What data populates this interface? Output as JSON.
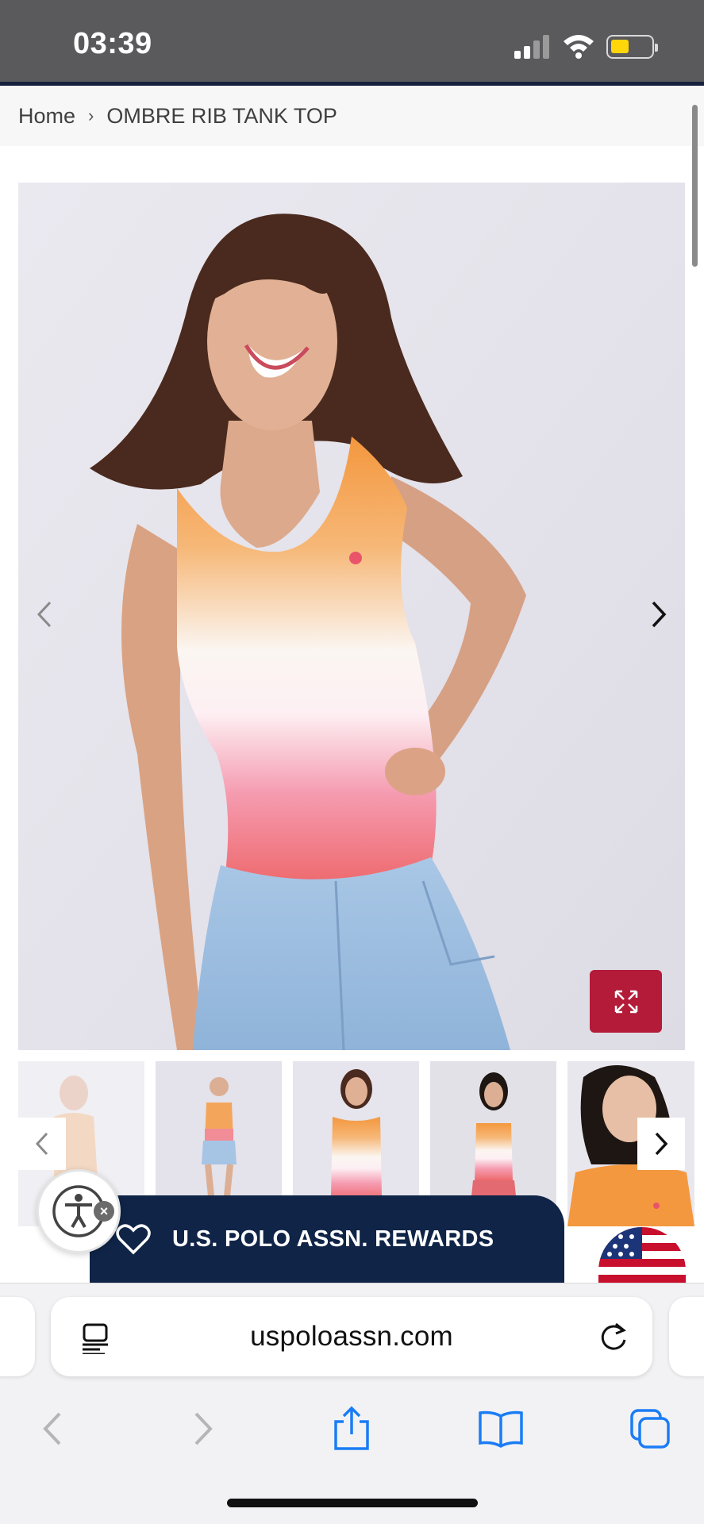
{
  "status_bar": {
    "time": "03:39",
    "battery_color": "#ffd60a"
  },
  "breadcrumb": {
    "home": "Home",
    "separator": "›",
    "current": "OMBRE RIB TANK TOP"
  },
  "gallery": {
    "main_image_alt": "Model wearing ombre rib tank top",
    "prev_icon": "chevron-left-icon",
    "next_icon": "chevron-right-icon",
    "expand_icon": "expand-icon",
    "thumbnail_count": 5
  },
  "rewards": {
    "label": "U.S. POLO ASSN. REWARDS",
    "icon": "heart-icon",
    "background": "#0f2447"
  },
  "accessibility": {
    "icon": "accessibility-icon",
    "close_icon": "close-icon",
    "close_glyph": "×"
  },
  "browser": {
    "url": "uspoloassn.com",
    "reader_icon": "reader-icon",
    "reload_icon": "reload-icon",
    "toolbar": [
      "back-icon",
      "forward-icon",
      "share-icon",
      "bookmarks-icon",
      "tabs-icon"
    ],
    "accent": "#1a7cf5"
  },
  "colors": {
    "brand_red": "#b31b38",
    "brand_navy": "#0f2447"
  }
}
